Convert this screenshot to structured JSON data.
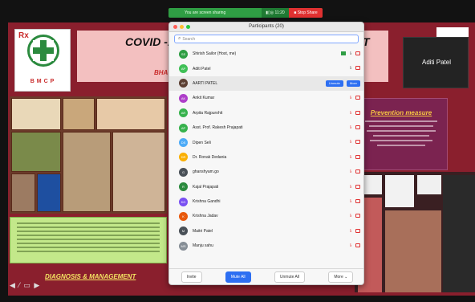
{
  "share_bar": {
    "status": "You are screen sharing",
    "controls": "▮▯◎ 11:20",
    "stop_label": "■ Stop Share"
  },
  "slide": {
    "title_left": "COVID -1",
    "title_right": "T",
    "subtitle": "BHA",
    "logo_text": "BMCP",
    "logo_rx": "Rx",
    "diagnosis": "DIAGNOSIS & MANAGEMENT",
    "prevention": "Prevention measure",
    "nav": "◀ ⁄ ▭ ▶"
  },
  "video": {
    "name": "Aditi Patel"
  },
  "panel": {
    "title": "Participants (20)",
    "search_placeholder": "Search",
    "participants": [
      {
        "initials": "SS",
        "name": "Shirish Sailor (Host, me)",
        "color": "#2f9e44"
      },
      {
        "initials": "AP",
        "name": "Aditi Patel",
        "color": "#40c057"
      },
      {
        "initials": "AP",
        "name": "AARTI PATEL",
        "color": "#5c4033"
      },
      {
        "initials": "AK",
        "name": "Ankit Kumar",
        "color": "#ae3ec9"
      },
      {
        "initials": "AR",
        "name": "Arpita Rajpurohit",
        "color": "#37b24d"
      },
      {
        "initials": "AP",
        "name": "Asst. Prof. Rakesh Prajapati",
        "color": "#37b24d"
      },
      {
        "initials": "DS",
        "name": "Dipen Seli",
        "color": "#4dabf7"
      },
      {
        "initials": "DR",
        "name": "Dr. Ronak Dedania",
        "color": "#fab005"
      },
      {
        "initials": "G",
        "name": "ghanshyam.go",
        "color": "#495057"
      },
      {
        "initials": "R",
        "name": "Kajal Prajapati",
        "color": "#2b8a3e"
      },
      {
        "initials": "KG",
        "name": "Krishna Gandhi",
        "color": "#7950f2"
      },
      {
        "initials": "K",
        "name": "Krishna Jadav",
        "color": "#e8590c"
      },
      {
        "initials": "M",
        "name": "Maitri Patel",
        "color": "#495057"
      },
      {
        "initials": "MS",
        "name": "Manju sahu",
        "color": "#868e96"
      }
    ],
    "unmute_label": "Unmute",
    "more_label": "More",
    "footer": {
      "invite": "Invite",
      "mute_all": "Mute All",
      "unmute_all": "Unmute All",
      "more": "More ⌄"
    }
  }
}
